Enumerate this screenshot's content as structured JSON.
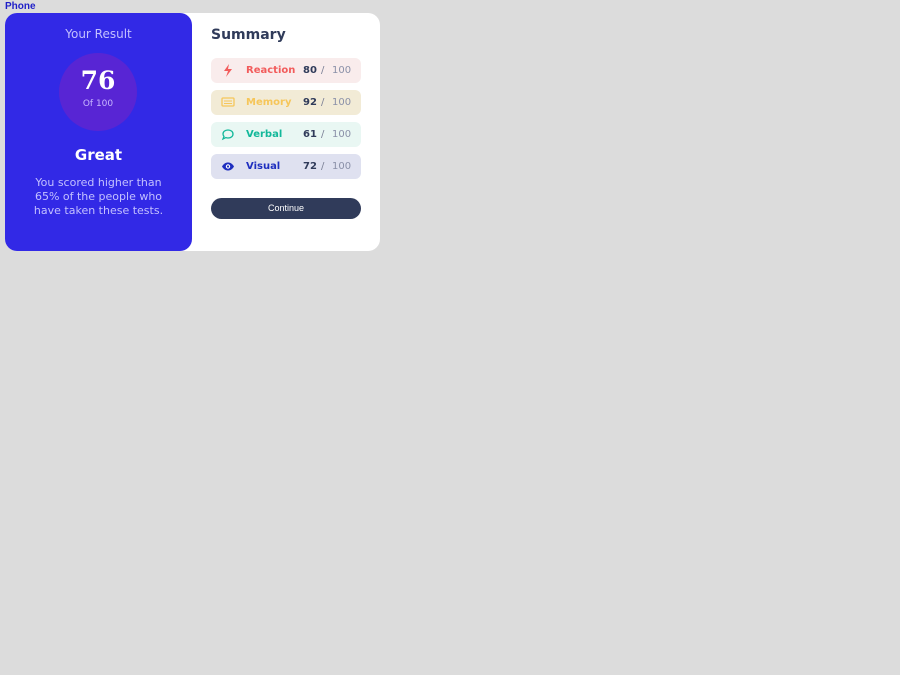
{
  "page": {
    "label": "Phone"
  },
  "result": {
    "title": "Your Result",
    "score": "76",
    "out_of": "Of 100",
    "grade": "Great",
    "description": "You scored higher than 65% of the people who have taken these tests."
  },
  "summary": {
    "title": "Summary",
    "items": [
      {
        "label": "Reaction",
        "value": "80",
        "separator": "/",
        "max": "100",
        "color": "#f25c5c",
        "icon": "lightning-icon"
      },
      {
        "label": "Memory",
        "value": "92",
        "separator": "/",
        "max": "100",
        "color": "#f6c65a",
        "icon": "memory-icon"
      },
      {
        "label": "Verbal",
        "value": "61",
        "separator": "/",
        "max": "100",
        "color": "#12b89a",
        "icon": "chat-bubble-icon"
      },
      {
        "label": "Visual",
        "value": "72",
        "separator": "/",
        "max": "100",
        "color": "#1f2fbf",
        "icon": "eye-icon"
      }
    ],
    "continue_label": "Continue"
  },
  "colors": {
    "background": "#dcdcdc",
    "result_panel": "#3229e6",
    "score_circle": "#5825d4",
    "button": "#303b5a"
  }
}
